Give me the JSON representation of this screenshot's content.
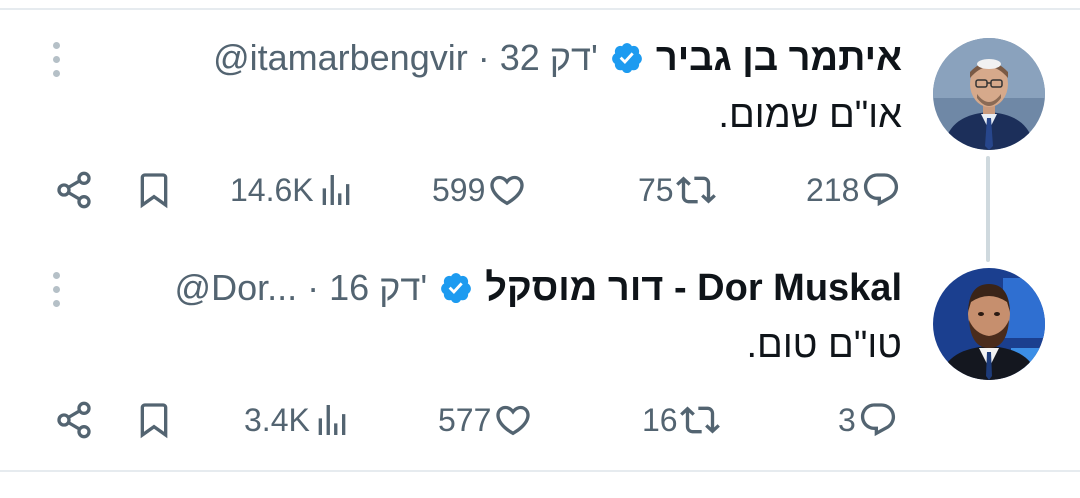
{
  "colors": {
    "accent": "#1d9bf0",
    "muted": "#536471",
    "text": "#0f1419"
  },
  "tweets": [
    {
      "name": "איתמר בן גביר",
      "verified": true,
      "meta": "@itamarbengvir · 32 דק'",
      "text": "או\"ם שמום.",
      "stats": {
        "replies": "218",
        "retweets": "75",
        "likes": "599",
        "views": "14.6K"
      },
      "icons": [
        "more-icon",
        "verified-badge-icon",
        "reply-icon",
        "retweet-icon",
        "like-icon",
        "views-icon",
        "bookmark-icon",
        "share-icon"
      ]
    },
    {
      "name": "Dor Muskal - דור מוסקל",
      "verified": true,
      "meta": "@Dor... · 16 דק'",
      "text": "טו\"ם טום.",
      "stats": {
        "replies": "3",
        "retweets": "16",
        "likes": "577",
        "views": "3.4K"
      },
      "icons": [
        "more-icon",
        "verified-badge-icon",
        "reply-icon",
        "retweet-icon",
        "like-icon",
        "views-icon",
        "bookmark-icon",
        "share-icon"
      ]
    }
  ]
}
